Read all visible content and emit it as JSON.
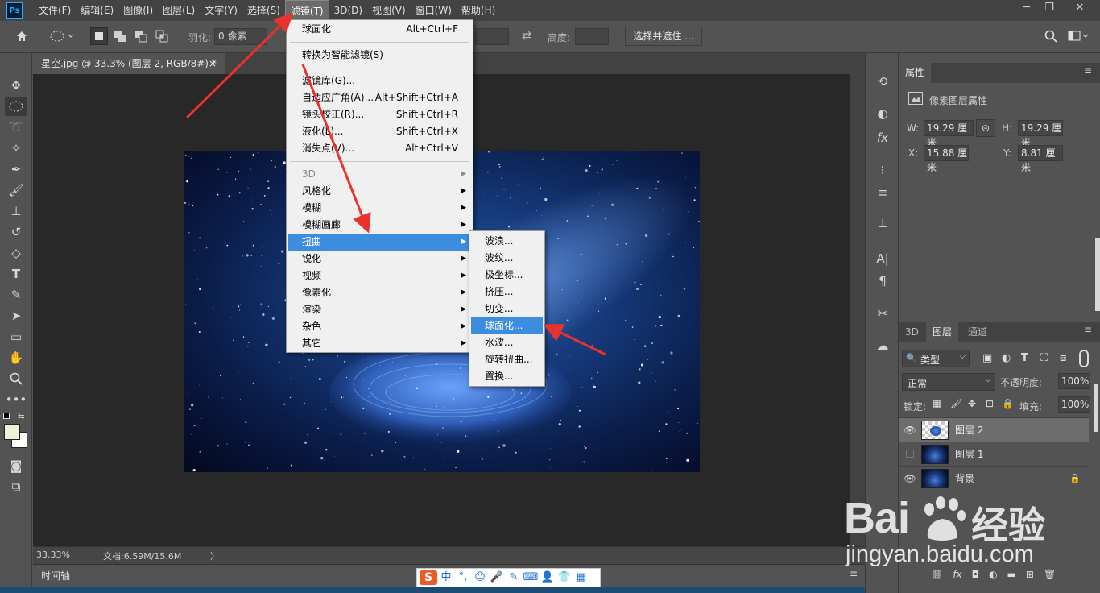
{
  "menubar": {
    "logo": "Ps",
    "items": [
      "文件(F)",
      "编辑(E)",
      "图像(I)",
      "图层(L)",
      "文字(Y)",
      "选择(S)",
      "滤镜(T)",
      "3D(D)",
      "视图(V)",
      "窗口(W)",
      "帮助(H)"
    ],
    "active_index": 6,
    "window_controls": [
      "─",
      "❐",
      "✕"
    ]
  },
  "options_bar": {
    "feather_label": "羽化:",
    "feather_value": "0 像素",
    "height_label": "高度:",
    "select_mask": "选择并遮住 ..."
  },
  "document": {
    "tab_title": "星空.jpg @ 33.3% (图层 2, RGB/8#) *",
    "tab_close": "×",
    "zoom": "33.33%",
    "doc_info": "文档:6.59M/15.6M",
    "status_arrow": "〉",
    "timeline": "时间轴"
  },
  "filter_menu": {
    "items": [
      {
        "label": "球面化",
        "shortcut": "Alt+Ctrl+F"
      },
      {
        "label": "转换为智能滤镜(S)",
        "shortcut": ""
      },
      {
        "label": "滤镜库(G)...",
        "shortcut": ""
      },
      {
        "label": "自适应广角(A)...",
        "shortcut": "Alt+Shift+Ctrl+A"
      },
      {
        "label": "镜头校正(R)...",
        "shortcut": "Shift+Ctrl+R"
      },
      {
        "label": "液化(L)...",
        "shortcut": "Shift+Ctrl+X"
      },
      {
        "label": "消失点(V)...",
        "shortcut": "Alt+Ctrl+V"
      },
      {
        "label": "3D",
        "submenu": true,
        "disabled": true
      },
      {
        "label": "风格化",
        "submenu": true
      },
      {
        "label": "模糊",
        "submenu": true
      },
      {
        "label": "模糊画廊",
        "submenu": true
      },
      {
        "label": "扭曲",
        "submenu": true,
        "highlighted": true
      },
      {
        "label": "锐化",
        "submenu": true
      },
      {
        "label": "视频",
        "submenu": true
      },
      {
        "label": "像素化",
        "submenu": true
      },
      {
        "label": "渲染",
        "submenu": true
      },
      {
        "label": "杂色",
        "submenu": true
      },
      {
        "label": "其它",
        "submenu": true
      }
    ]
  },
  "distort_submenu": {
    "items": [
      "波浪...",
      "波纹...",
      "极坐标...",
      "挤压...",
      "切变...",
      "球面化...",
      "水波...",
      "旋转扭曲...",
      "置换..."
    ],
    "highlighted_index": 5
  },
  "properties": {
    "tab": "属性",
    "type_label": "像素图层属性",
    "w_label": "W:",
    "w_value": "19.29 厘米",
    "h_label": "H:",
    "h_value": "19.29 厘米",
    "x_label": "X:",
    "x_value": "15.88 厘米",
    "y_label": "Y:",
    "y_value": "8.81 厘米"
  },
  "layers": {
    "tabs": [
      "3D",
      "图层",
      "通道"
    ],
    "active_tab": 1,
    "filter_kind": "类型",
    "blend_mode": "正常",
    "opacity_label": "不透明度:",
    "opacity_value": "100%",
    "lock_label": "锁定:",
    "fill_label": "填充:",
    "fill_value": "100%",
    "rows": [
      {
        "name": "图层 2",
        "visible": true,
        "selected": true
      },
      {
        "name": "图层 1",
        "visible": false,
        "selected": false
      },
      {
        "name": "背景",
        "visible": true,
        "selected": false,
        "locked": true
      }
    ],
    "footer_icons": [
      "link-icon",
      "fx-icon",
      "mask-icon",
      "adjustment-icon",
      "folder-icon",
      "new-layer-icon",
      "trash-icon"
    ]
  },
  "ime": {
    "logo": "S",
    "items": [
      "中",
      "°,",
      "☺",
      "🎤",
      "✎",
      "⌨",
      "👤",
      "👕",
      "▦"
    ]
  },
  "watermark": {
    "brand_left": "Bai",
    "brand_right": "经验",
    "url": "jingyan.baidu.com"
  },
  "colors": {
    "menu_highlight": "#3c8de0",
    "annotation_red": "#e8322e",
    "ps_blue": "#31a8ff"
  }
}
